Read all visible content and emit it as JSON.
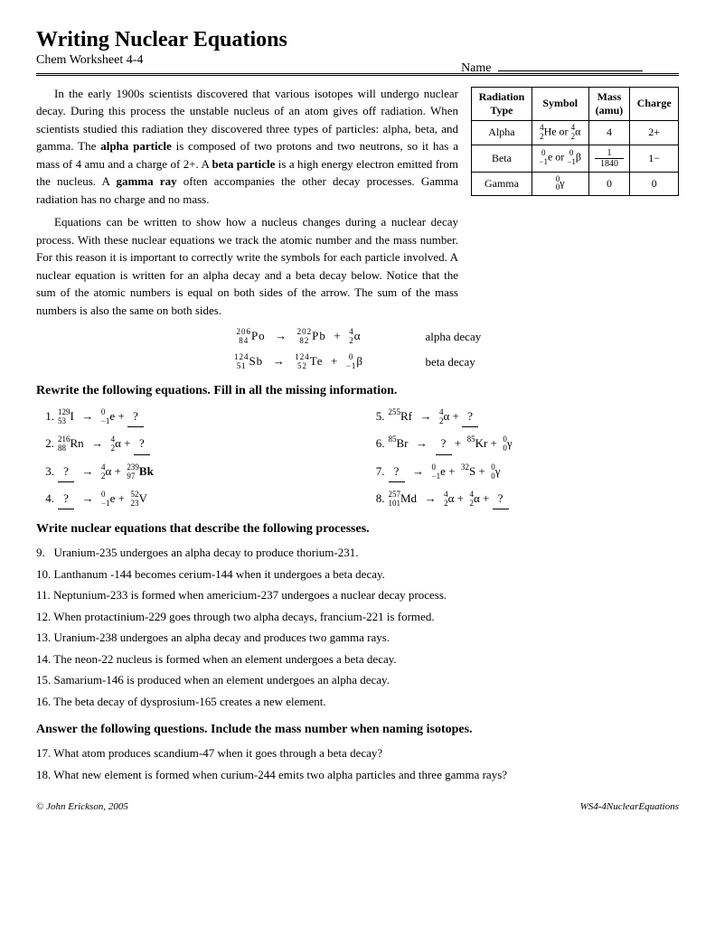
{
  "title": "Writing Nuclear Equations",
  "subtitle": "Chem Worksheet 4-4",
  "name_label": "Name",
  "intro_paragraphs": [
    "In the early 1900s scientists discovered that various isotopes will undergo nuclear decay. During this process the unstable nucleus of an atom gives off radiation. When scientists studied this radiation they discovered three types of particles: alpha, beta, and gamma. The alpha particle is composed of two protons and two neutrons, so it has a mass of 4 amu and a charge of 2+. A beta particle is a high energy electron emitted from the nucleus. A gamma ray often accompanies the other decay processes. Gamma radiation has no charge and no mass.",
    "Equations can be written to show how a nucleus changes during a nuclear decay process. With these nuclear equations we track the atomic number and the mass number. For this reason it is important to correctly write the symbols for each particle involved. A nuclear equation is written for an alpha decay and a beta decay below. Notice that the sum of the atomic numbers is equal on both sides of the arrow. The sum of the mass numbers is also the same on both sides."
  ],
  "table": {
    "headers": [
      "Radiation Type",
      "Symbol",
      "Mass (amu)",
      "Charge"
    ],
    "rows": [
      [
        "Alpha",
        "⁴₂He or ⁴₂α",
        "4",
        "2+"
      ],
      [
        "Beta",
        "⁰₋₁e or ⁰₋₁β",
        "1/1840",
        "1−"
      ],
      [
        "Gamma",
        "⁰₀γ",
        "0",
        "0"
      ]
    ]
  },
  "alpha_decay_label": "alpha decay",
  "beta_decay_label": "beta decay",
  "section1_header": "Rewrite the following equations. Fill in all the missing information.",
  "section2_header": "Write nuclear equations that describe the following processes.",
  "section3_header": "Answer the following questions. Include the mass number when naming isotopes.",
  "problems_col1": [
    {
      "num": "1.",
      "equation": "¹²⁹₅₃I → ⁰₋₁e + ?"
    },
    {
      "num": "2.",
      "equation": "²¹⁶₈₈Rn → ⁴₂α + ?"
    },
    {
      "num": "3.",
      "equation": "? → ⁴₂α + ²³⁹₉₇Bk"
    },
    {
      "num": "4.",
      "equation": "? → ⁰₋₁e + ⁵²₂₃V"
    }
  ],
  "problems_col2": [
    {
      "num": "5.",
      "equation": "²⁵⁵Rf → ⁴₂α + ?"
    },
    {
      "num": "6.",
      "equation": "⁸⁵Br → ? + ⁸⁵Kr + ⁰₀γ"
    },
    {
      "num": "7.",
      "equation": "? → ⁰₋₁e + ³²S + ⁰₀γ"
    },
    {
      "num": "8.",
      "equation": "²⁵⁷₁₀₁Md → ⁴₂α + ⁴₂α + ?"
    }
  ],
  "word_problems": [
    "9.  Uranium-235 undergoes an alpha decay to produce thorium-231.",
    "10. Lanthanum -144 becomes cerium-144 when it undergoes a beta decay.",
    "11. Neptunium-233 is formed when americium-237 undergoes a nuclear decay process.",
    "12. When protactinium-229 goes through two alpha decays, francium-221 is formed.",
    "13. Uranium-238 undergoes an alpha decay and produces two gamma rays.",
    "14. The neon-22 nucleus is formed when an element undergoes a beta decay.",
    "15. Samarium-146 is produced when an element undergoes an alpha decay.",
    "16. The beta decay of dysprosium-165 creates a new element."
  ],
  "answer_questions": [
    "17. What atom produces scandium-47 when it goes through a beta decay?",
    "18. What new element is formed when curium-244 emits two alpha particles and three gamma rays?"
  ],
  "footer_left": "© John Erickson, 2005",
  "footer_right": "WS4-4NuclearEquations"
}
